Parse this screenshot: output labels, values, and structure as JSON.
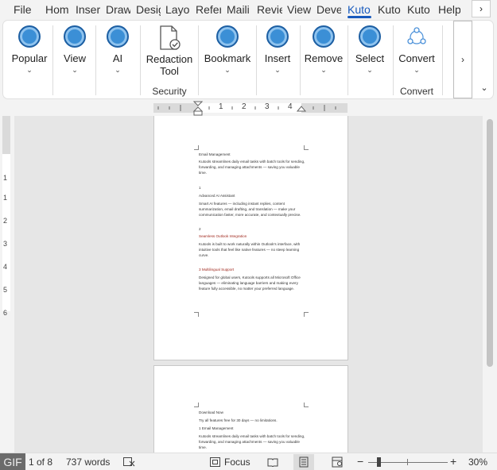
{
  "tabs": [
    {
      "label": "File"
    },
    {
      "label": "Hom"
    },
    {
      "label": "Inser"
    },
    {
      "label": "Draw"
    },
    {
      "label": "Desig"
    },
    {
      "label": "Layo"
    },
    {
      "label": "Refer"
    },
    {
      "label": "Maili"
    },
    {
      "label": "Revie"
    },
    {
      "label": "View"
    },
    {
      "label": "Deve"
    },
    {
      "label": "Kuto"
    },
    {
      "label": "Kuto"
    },
    {
      "label": "Kuto"
    },
    {
      "label": "Help"
    }
  ],
  "active_tab_index": 11,
  "tab_more_glyph": "›",
  "ribbon": {
    "buttons": [
      {
        "label": "Popular",
        "caret": "⌄"
      },
      {
        "label": "View",
        "caret": "⌄"
      },
      {
        "label": "AI",
        "caret": "⌄"
      },
      {
        "label": "Redaction\nTool",
        "line1": "Redaction",
        "line2": "Tool"
      },
      {
        "label": "Bookmark",
        "caret": "⌄"
      },
      {
        "label": "Insert",
        "caret": "⌄"
      },
      {
        "label": "Remove",
        "caret": "⌄"
      },
      {
        "label": "Select",
        "caret": "⌄"
      },
      {
        "label": "Convert",
        "caret": "⌄"
      }
    ],
    "group_security": "Security",
    "group_convert": "Convert",
    "scroll_glyph": "›",
    "collapse_glyph": "⌄",
    "icon_color": "#3b8fd6"
  },
  "hruler": {
    "ticks": [
      "1",
      "2",
      "3",
      "4"
    ]
  },
  "vruler": {
    "ticks": [
      "1",
      "1",
      "2",
      "3",
      "4",
      "5",
      "6"
    ]
  },
  "page1": {
    "lines": [
      "Email Management",
      "Kutools streamlines daily email tasks with batch tools for sending, forwarding, and managing attachments — saving you valuable time.",
      "1",
      "Advanced AI Assistant",
      "Smart AI features — including instant replies, content summarization, email drafting, and translation — make your communication faster, more accurate, and contextually precise.",
      "2",
      "Seamless Outlook Integration",
      "Kutools is built to work naturally within Outlook's interface, with intuitive tools that feel like native features — no steep learning curve.",
      "3 Multilingual Support",
      "Designed for global users, Kutools supports all Microsoft Office languages — eliminating language barriers and making every feature fully accessible, no matter your preferred language."
    ]
  },
  "page2": {
    "lines": [
      "Download Now",
      "Try all features free for 30 days — no limitations.",
      "1 Email Management",
      "Kutools streamlines daily email tasks with batch tools for sending, forwarding, and managing attachments — saving you valuable time."
    ]
  },
  "status": {
    "gif": "GIF",
    "page_info": "1 of 8",
    "words": "737 words",
    "proof_icon": "□̸",
    "focus": "Focus",
    "zoom_minus": "−",
    "zoom_plus": "+",
    "zoom": "30%",
    "zoom_level": 0.3
  },
  "accent_color": "#185abd"
}
